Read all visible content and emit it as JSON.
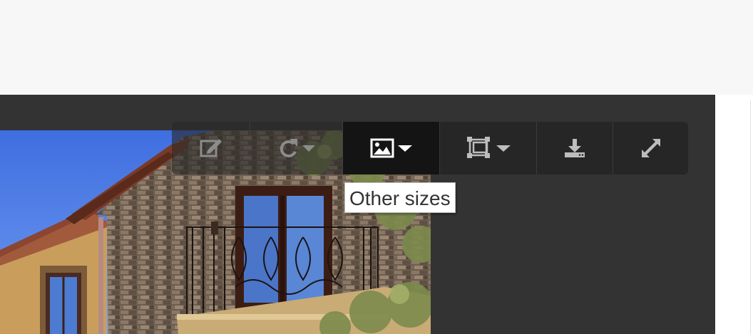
{
  "toolbar": {
    "buttons": [
      {
        "icon": "edit-icon",
        "caret": false
      },
      {
        "icon": "rotate-icon",
        "caret": true
      },
      {
        "icon": "image-icon",
        "caret": true,
        "active": true
      },
      {
        "icon": "crop-frame-icon",
        "caret": true
      },
      {
        "icon": "download-icon",
        "caret": false
      },
      {
        "icon": "expand-icon",
        "caret": false
      }
    ]
  },
  "tooltip": {
    "text": "Other sizes"
  },
  "colors": {
    "page_bg": "#f7f7f7",
    "viewer_bg": "#333333",
    "toolbar_bg": "#262626",
    "active_bg": "#141414",
    "icon_dim": "#8c8c8c",
    "icon_light": "#bdbdbd",
    "icon_active": "#ffffff"
  }
}
